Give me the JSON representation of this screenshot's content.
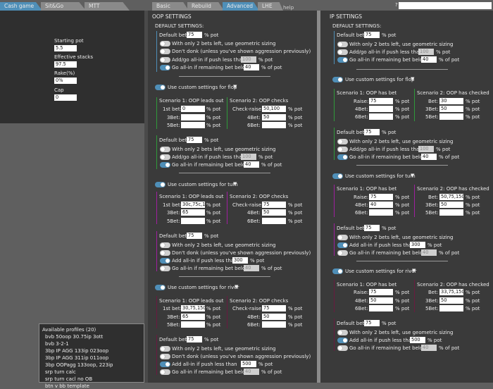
{
  "top_tabs": [
    "Cash game",
    "Sit&Go",
    "MTT"
  ],
  "settings_tabs": [
    "Basic",
    "Rebuild",
    "Advanced",
    "LHE",
    "help"
  ],
  "top_right": {
    "field_label": "?",
    "field_value": ""
  },
  "left_panel": {
    "starting_pot_label": "Starting pot",
    "starting_pot": "5.5",
    "eff_stacks_label": "Effective stacks",
    "eff_stacks": "97.5",
    "rake_label": "Rake(%)",
    "rake": "0%",
    "cap_label": "Cap",
    "cap": "0"
  },
  "profiles": {
    "title": "Available profiles (20)",
    "items": [
      "bvb 50oop 30.75ip 3ott",
      "bvb 3-2-1",
      "3bp IP AGG 133ip 023oop",
      "3bp IP AGG 311ip 011oop",
      "3bp OOPagg 133oop, 223ip",
      "srp turn calc",
      "srp turn cacl no OB",
      "btn v bb template"
    ]
  },
  "oop": {
    "title": "OOP SETTINGS",
    "default_title": "DEFAULT SETTINGS:",
    "default_bet_label": "Default bet:",
    "default_bet": "75",
    "pct": "% pot",
    "pct_of": "% of pot",
    "geo_label": "With only 2 bets left, use geometric sizing",
    "dont_donk_label": "Don't donk (unless you've shown aggression previously)",
    "addallin_label": "Add/go all-in if push less than",
    "addallin": "100",
    "goallin_label": "Go all-in if remaining bet below",
    "goallin": "40",
    "add_allin_label2": "Add all-in if push less than",
    "custom_flop": "Use custom settings for flop",
    "custom_turn": "Use custom settings for turn",
    "custom_river": "Use custom settings for river",
    "sc1_title": "Scenario 1: OOP leads out",
    "sc2_title": "Scenario 2: OOP checks",
    "bet1_label": "1st bet:",
    "bet3_label": "3Bet:",
    "bet5_label": "5Bet:",
    "check_raise_label": "Check-raise:",
    "bet4_label": "4Bet:",
    "bet6_label": "6Bet:",
    "flop": {
      "lead": "0",
      "lead3": "",
      "lead5": "",
      "xr": "50,100",
      "xr4": "50",
      "xr6": "",
      "def_bet": "75",
      "addallin": "100",
      "goallin": "40"
    },
    "turn": {
      "lead": "30c,75c,1:",
      "lead3": "65",
      "lead5": "",
      "xr": "75",
      "xr4": "50",
      "xr6": "",
      "def_bet": "75",
      "addallin": "300",
      "goallin": "40"
    },
    "river": {
      "lead": "30,75,150",
      "lead3": "65",
      "lead5": "",
      "xr": "75",
      "xr4": "50",
      "xr6": "",
      "def_bet": "75",
      "addallin": "500",
      "goallin": "40"
    }
  },
  "ip": {
    "title": "IP SETTINGS",
    "default_title": "DEFAULT SETTINGS:",
    "default_bet_label": "Default bet:",
    "default_bet": "75",
    "pct": "% pot",
    "pct_of": "% of pot",
    "geo_label": "With only 2 bets left, use geometric sizing",
    "addallin_label": "Add/go all-in if push less than",
    "addallin": "100",
    "goallin_label": "Go all-in if remaining bet below",
    "goallin": "40",
    "add_allin_label2": "Add all-in if push less than",
    "custom_flop": "Use custom settings for flop",
    "custom_turn": "Use custom settings for turn",
    "custom_river": "Use custom settings for river",
    "sc1_title": "Scenario 1: OOP has bet",
    "sc2_title": "Scenario 2: OOP has checked",
    "raise_label": "Raise:",
    "bet4_label": "4Bet:",
    "bet6_label": "6Bet:",
    "bet_label": "Bet:",
    "bet3_label": "3Bet:",
    "bet5_label": "5Bet:",
    "flop": {
      "raise": "75",
      "r4": "",
      "r6": "",
      "bet": "30",
      "b3": "50",
      "b5": "",
      "def_bet": "75",
      "addallin": "100",
      "goallin": "40"
    },
    "turn": {
      "raise": "75",
      "r4": "40",
      "r6": "",
      "bet": "50,75,150",
      "b3": "50",
      "b5": "",
      "def_bet": "75",
      "addallin": "300",
      "goallin": "40"
    },
    "river": {
      "raise": "75",
      "r4": "50",
      "r6": "",
      "bet": "33,75,150",
      "b3": "50",
      "b5": "",
      "def_bet": "75",
      "addallin": "500",
      "goallin": "40"
    }
  },
  "colors": {
    "accent": "#4f8fb8",
    "flop": "#2f9a3a",
    "turn": "#a01fa0",
    "river": "#6a1a40"
  }
}
